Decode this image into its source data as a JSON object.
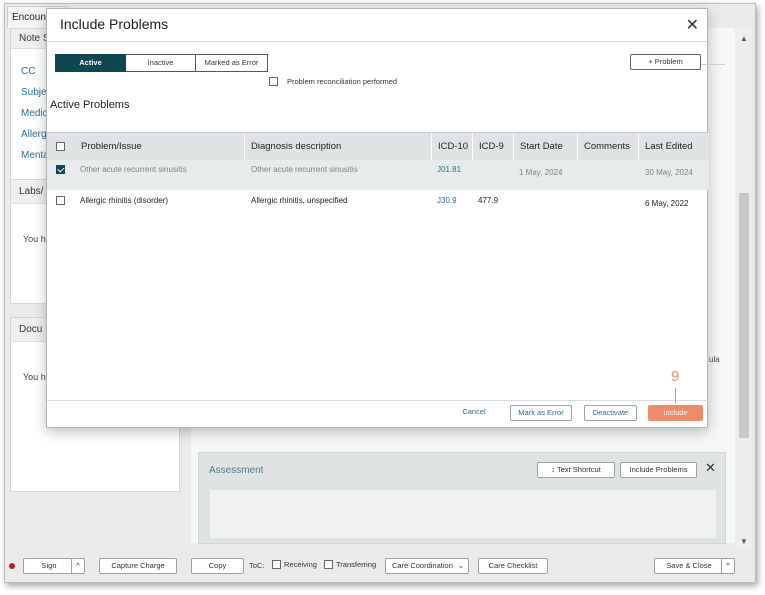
{
  "app": {
    "tab_label": "Encount",
    "left_sections": {
      "note_header": "Note S",
      "items": [
        "CC",
        "Subje",
        "Medic",
        "Allerg",
        "Menta"
      ],
      "labs_header": "Labs/",
      "labs_text": "You h",
      "docs_header": "Docu",
      "docs_text": "You ha"
    },
    "stray_text": "ula",
    "assessment": {
      "title": "Assessment",
      "text_shortcut": "Text Shortcut",
      "include_problems": "Include Problems"
    },
    "bottom_bar": {
      "sign": "Sign",
      "capture_charge": "Capture Charge",
      "copy": "Copy",
      "toc_label": "ToC:",
      "receiving": "Receiving",
      "transferring": "Transferring",
      "care_coordination": "Care Coordination",
      "care_checklist": "Care Checklist",
      "save_close": "Save & Close"
    }
  },
  "modal": {
    "title": "Include Problems",
    "tabs": [
      "Active",
      "Inactive",
      "Marked as Error"
    ],
    "active_tab": "Active",
    "add_problem": "+ Problem",
    "reconciliation_label": "Problem reconciliation performed",
    "section_title": "Active Problems",
    "columns": [
      "Problem/Issue",
      "Diagnosis description",
      "ICD-10",
      "ICD-9",
      "Start Date",
      "Comments",
      "Last Edited"
    ],
    "rows": [
      {
        "checked": true,
        "problem": "Other acute recurrent sinusitis",
        "diagnosis": "Other acute recurrent sinusitis",
        "icd10": "J01.81",
        "icd9": "",
        "start_date": "1 May, 2024",
        "comments": "",
        "last_edited": "30 May, 2024"
      },
      {
        "checked": false,
        "problem": "Allergic rhinitis (disorder)",
        "diagnosis": "Allergic rhinitis, unspecified",
        "icd10": "J30.9",
        "icd9": "477.9",
        "start_date": "",
        "comments": "",
        "last_edited": "6 May, 2022"
      }
    ],
    "footer": {
      "cancel": "Cancel",
      "mark_as_error": "Mark as Error",
      "deactivate": "Deactivate",
      "include": "Include"
    },
    "callout_number": "9"
  },
  "colors": {
    "accent_dark": "#0e4752",
    "include_orange": "#ef8a6a",
    "link_blue": "#2c6c8a"
  }
}
